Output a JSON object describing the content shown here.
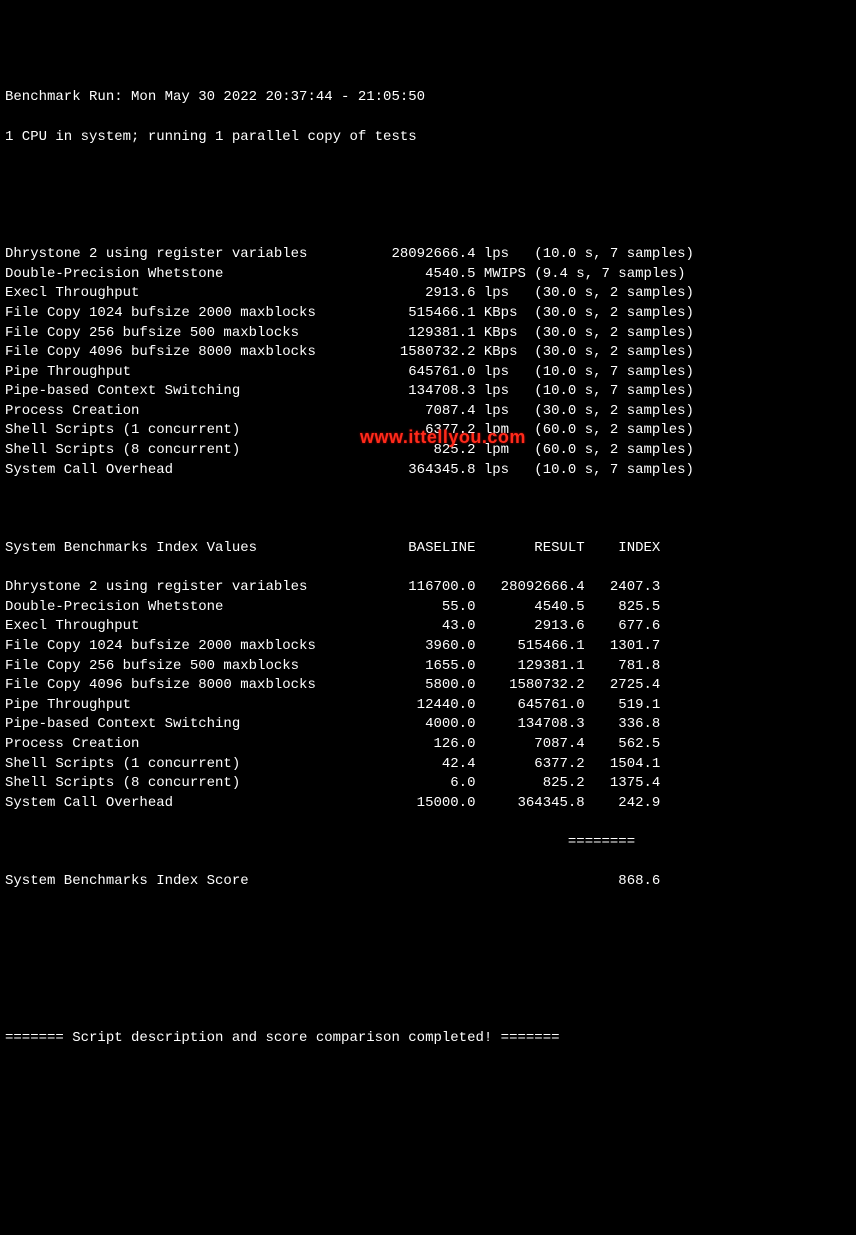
{
  "header": {
    "run_line": "Benchmark Run: Mon May 30 2022 20:37:44 - 21:05:50",
    "cpu_line": "1 CPU in system; running 1 parallel copy of tests"
  },
  "results": [
    {
      "name": "Dhrystone 2 using register variables",
      "value": "28092666.4",
      "unit": "lps",
      "time": "10.0",
      "samples": "7"
    },
    {
      "name": "Double-Precision Whetstone",
      "value": "4540.5",
      "unit": "MWIPS",
      "time": "9.4",
      "samples": "7"
    },
    {
      "name": "Execl Throughput",
      "value": "2913.6",
      "unit": "lps",
      "time": "30.0",
      "samples": "2"
    },
    {
      "name": "File Copy 1024 bufsize 2000 maxblocks",
      "value": "515466.1",
      "unit": "KBps",
      "time": "30.0",
      "samples": "2"
    },
    {
      "name": "File Copy 256 bufsize 500 maxblocks",
      "value": "129381.1",
      "unit": "KBps",
      "time": "30.0",
      "samples": "2"
    },
    {
      "name": "File Copy 4096 bufsize 8000 maxblocks",
      "value": "1580732.2",
      "unit": "KBps",
      "time": "30.0",
      "samples": "2"
    },
    {
      "name": "Pipe Throughput",
      "value": "645761.0",
      "unit": "lps",
      "time": "10.0",
      "samples": "7"
    },
    {
      "name": "Pipe-based Context Switching",
      "value": "134708.3",
      "unit": "lps",
      "time": "10.0",
      "samples": "7"
    },
    {
      "name": "Process Creation",
      "value": "7087.4",
      "unit": "lps",
      "time": "30.0",
      "samples": "2"
    },
    {
      "name": "Shell Scripts (1 concurrent)",
      "value": "6377.2",
      "unit": "lpm",
      "time": "60.0",
      "samples": "2"
    },
    {
      "name": "Shell Scripts (8 concurrent)",
      "value": "825.2",
      "unit": "lpm",
      "time": "60.0",
      "samples": "2"
    },
    {
      "name": "System Call Overhead",
      "value": "364345.8",
      "unit": "lps",
      "time": "10.0",
      "samples": "7"
    }
  ],
  "index_header": {
    "title": "System Benchmarks Index Values",
    "col_baseline": "BASELINE",
    "col_result": "RESULT",
    "col_index": "INDEX"
  },
  "index_rows": [
    {
      "name": "Dhrystone 2 using register variables",
      "baseline": "116700.0",
      "result": "28092666.4",
      "index": "2407.3"
    },
    {
      "name": "Double-Precision Whetstone",
      "baseline": "55.0",
      "result": "4540.5",
      "index": "825.5"
    },
    {
      "name": "Execl Throughput",
      "baseline": "43.0",
      "result": "2913.6",
      "index": "677.6"
    },
    {
      "name": "File Copy 1024 bufsize 2000 maxblocks",
      "baseline": "3960.0",
      "result": "515466.1",
      "index": "1301.7"
    },
    {
      "name": "File Copy 256 bufsize 500 maxblocks",
      "baseline": "1655.0",
      "result": "129381.1",
      "index": "781.8"
    },
    {
      "name": "File Copy 4096 bufsize 8000 maxblocks",
      "baseline": "5800.0",
      "result": "1580732.2",
      "index": "2725.4"
    },
    {
      "name": "Pipe Throughput",
      "baseline": "12440.0",
      "result": "645761.0",
      "index": "519.1"
    },
    {
      "name": "Pipe-based Context Switching",
      "baseline": "4000.0",
      "result": "134708.3",
      "index": "336.8"
    },
    {
      "name": "Process Creation",
      "baseline": "126.0",
      "result": "7087.4",
      "index": "562.5"
    },
    {
      "name": "Shell Scripts (1 concurrent)",
      "baseline": "42.4",
      "result": "6377.2",
      "index": "1504.1"
    },
    {
      "name": "Shell Scripts (8 concurrent)",
      "baseline": "6.0",
      "result": "825.2",
      "index": "1375.4"
    },
    {
      "name": "System Call Overhead",
      "baseline": "15000.0",
      "result": "364345.8",
      "index": "242.9"
    }
  ],
  "divider": "                                                                   ========",
  "score": {
    "label": "System Benchmarks Index Score",
    "value": "868.6"
  },
  "footer": "======= Script description and score comparison completed! =======",
  "watermark": "www.ittellyou.com"
}
